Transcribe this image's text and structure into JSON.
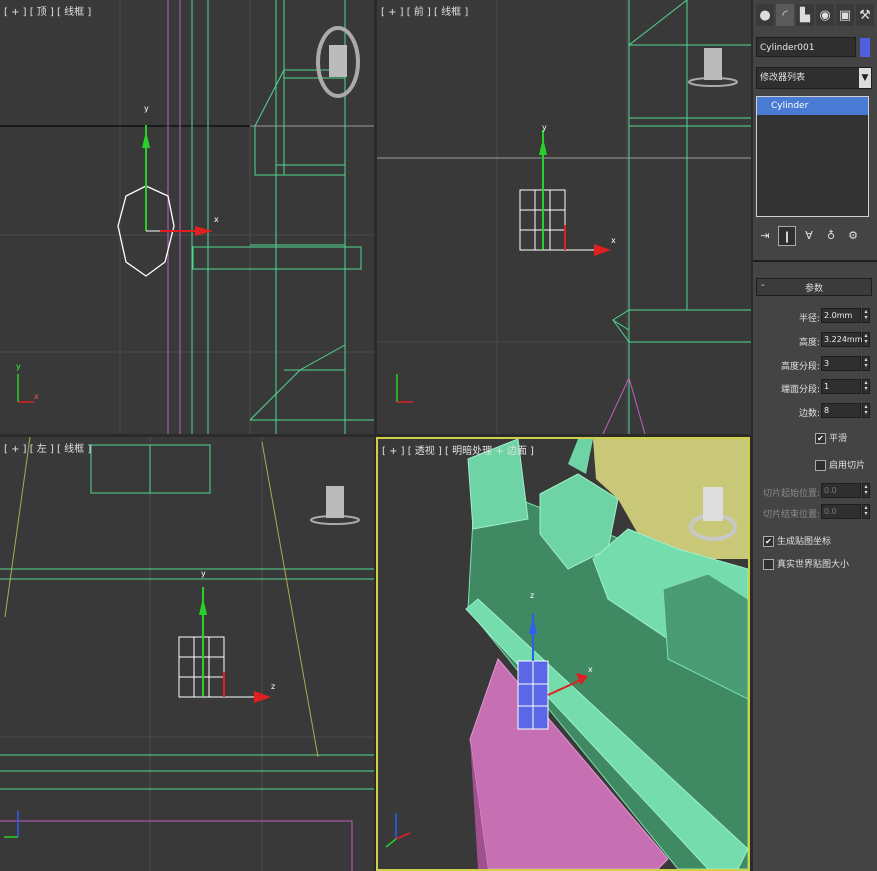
{
  "viewports": {
    "top": {
      "label": "[ + ] [ 顶 ] [ 线框 ]"
    },
    "front": {
      "label": "[ + ] [ 前 ] [ 线框 ]"
    },
    "left": {
      "label": "[ + ] [ 左 ] [ 线框 ]"
    },
    "perspective": {
      "label": "[ + ] [ 透视 ] [ 明暗处理 + 边面 ]"
    }
  },
  "axis_labels": {
    "x": "x",
    "y": "y",
    "z": "z"
  },
  "panel": {
    "tabs": [
      {
        "icon": "create-icon",
        "glyph": "●"
      },
      {
        "icon": "modify-icon",
        "glyph": "◜"
      },
      {
        "icon": "hierarchy-icon",
        "glyph": "▙"
      },
      {
        "icon": "motion-icon",
        "glyph": "◉"
      },
      {
        "icon": "display-icon",
        "glyph": "▣"
      },
      {
        "icon": "utilities-icon",
        "glyph": "⚒"
      }
    ],
    "object_name": "Cylinder001",
    "object_color": "#4f5fe0",
    "modifier_list": "修改器列表",
    "modifier_list_arrow": "▼",
    "stack_items": [
      "Cylinder"
    ],
    "stack_icons": [
      {
        "icon": "pin-stack-icon",
        "glyph": "⇥"
      },
      {
        "icon": "show-end-result-icon",
        "glyph": "❙"
      },
      {
        "icon": "make-unique-icon",
        "glyph": "∀"
      },
      {
        "icon": "remove-modifier-icon",
        "glyph": "♁"
      },
      {
        "icon": "configure-sets-icon",
        "glyph": "⚙"
      }
    ],
    "rollout_minus": "-",
    "rollout_title": "参数",
    "params": [
      {
        "label": "半径:",
        "value": "2.0mm"
      },
      {
        "label": "高度:",
        "value": "3.224mm"
      },
      {
        "label": "高度分段:",
        "value": "3"
      },
      {
        "label": "端面分段:",
        "value": "1"
      },
      {
        "label": "边数:",
        "value": "8"
      }
    ],
    "smooth": {
      "label": "平滑",
      "checked": "✔"
    },
    "slice_on": {
      "label": "启用切片",
      "checked": ""
    },
    "slice_params": [
      {
        "label": "切片起始位置:",
        "value": "0.0"
      },
      {
        "label": "切片结束位置:",
        "value": "0.0"
      }
    ],
    "gen_mapping": {
      "label": "生成贴图坐标",
      "checked": "✔"
    },
    "real_world": {
      "label": "真实世界贴图大小",
      "checked": ""
    }
  }
}
